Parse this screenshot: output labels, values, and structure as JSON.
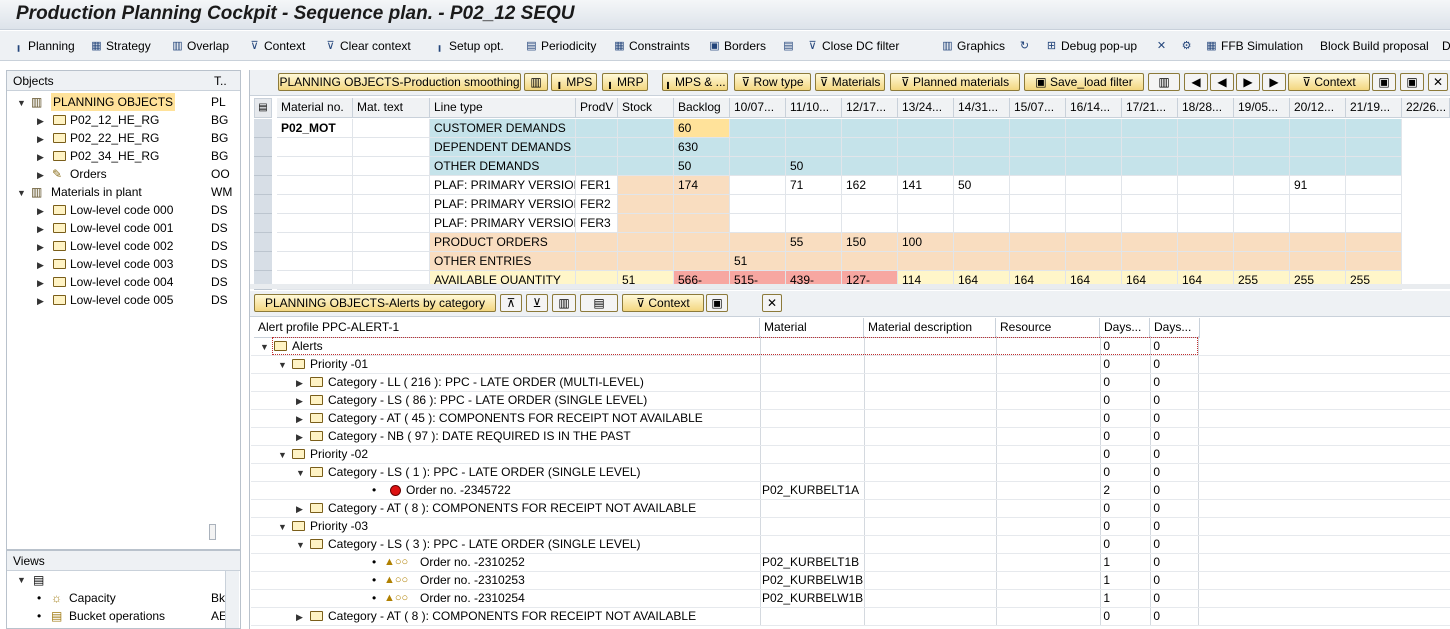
{
  "window": {
    "title": "Production Planning Cockpit - Sequence plan. - P02_12 SEQU"
  },
  "toolbar": {
    "items": [
      {
        "label": "Planning",
        "icon": "planning-icon"
      },
      {
        "label": "Strategy",
        "icon": "strategy-icon"
      },
      {
        "label": "Overlap",
        "icon": "overlap-icon"
      },
      {
        "label": "Context",
        "icon": "context-icon"
      },
      {
        "label": "Clear context",
        "icon": "clear-context-icon"
      },
      {
        "label": "Setup opt.",
        "icon": "setup-icon"
      },
      {
        "label": "Periodicity",
        "icon": "periodicity-icon"
      },
      {
        "label": "Constraints",
        "icon": "constraints-icon"
      },
      {
        "label": "Borders",
        "icon": "borders-icon"
      },
      {
        "label": "",
        "icon": "list-icon"
      },
      {
        "label": "Close DC filter",
        "icon": "filter-icon"
      },
      {
        "label": "Graphics",
        "icon": "graphics-icon"
      },
      {
        "label": "",
        "icon": "refresh-icon"
      },
      {
        "label": "Debug pop-up",
        "icon": "debug-icon"
      },
      {
        "label": "",
        "icon": "excel-icon"
      },
      {
        "label": "",
        "icon": "tools-icon"
      },
      {
        "label": "FFB Simulation",
        "icon": "simulation-icon"
      },
      {
        "label": "Block Build proposal",
        "icon": ""
      },
      {
        "label": "D",
        "icon": ""
      }
    ]
  },
  "objects_panel": {
    "header_col1": "Objects",
    "header_col2": "T..",
    "rows": [
      {
        "label": "PLANNING OBJECTS",
        "code": "PL"
      },
      {
        "label": "P02_12_HE_RG",
        "code": "BG"
      },
      {
        "label": "P02_22_HE_RG",
        "code": "BG"
      },
      {
        "label": "P02_34_HE_RG",
        "code": "BG"
      },
      {
        "label": "Orders",
        "code": "OO"
      },
      {
        "label": "Materials in plant",
        "code": "WM"
      },
      {
        "label": "Low-level code 000",
        "code": "DS"
      },
      {
        "label": "Low-level code 001",
        "code": "DS"
      },
      {
        "label": "Low-level code 002",
        "code": "DS"
      },
      {
        "label": "Low-level code 003",
        "code": "DS"
      },
      {
        "label": "Low-level code 004",
        "code": "DS"
      },
      {
        "label": "Low-level code 005",
        "code": "DS"
      }
    ]
  },
  "views_panel": {
    "header": "Views",
    "rows": [
      {
        "label": "Capacity",
        "code": "Bk"
      },
      {
        "label": "Bucket operations",
        "code": "AE"
      }
    ]
  },
  "upper_toolbar": {
    "buttons": [
      "PLANNING OBJECTS-Production smoothing",
      "",
      "MPS",
      "MRP",
      "MPS & ...",
      "Row type",
      "Materials",
      "Planned materials",
      "Save_load filter",
      "",
      "",
      "",
      "",
      "",
      "Context",
      "",
      "",
      ""
    ]
  },
  "upper_grid": {
    "headers": [
      "Material no.",
      "Mat. text",
      "Line type",
      "ProdV",
      "Stock",
      "Backlog",
      "10/07...",
      "11/10...",
      "12/17...",
      "13/24...",
      "14/31...",
      "15/07...",
      "16/14...",
      "17/21...",
      "18/28...",
      "19/05...",
      "20/12...",
      "21/19...",
      "22/26..."
    ],
    "material": "P02_MOT",
    "rows": [
      {
        "line": "CUSTOMER DEMANDS",
        "prodv": "",
        "stock": "",
        "vals": [
          "60",
          "",
          "",
          "",
          "",
          "",
          "",
          "",
          "",
          "",
          "",
          "",
          ""
        ],
        "style": "blue",
        "hl": {
          "0": "yellow"
        }
      },
      {
        "line": "DEPENDENT DEMANDS",
        "prodv": "",
        "stock": "",
        "vals": [
          "630",
          "",
          "",
          "",
          "",
          "",
          "",
          "",
          "",
          "",
          "",
          "",
          ""
        ],
        "style": "blue"
      },
      {
        "line": "OTHER DEMANDS",
        "prodv": "",
        "stock": "",
        "vals": [
          "50",
          "",
          "50",
          "",
          "",
          "",
          "",
          "",
          "",
          "",
          "",
          "",
          ""
        ],
        "style": "blue"
      },
      {
        "line": "PLAF: PRIMARY VERSION",
        "prodv": "FER1",
        "stock": "",
        "vals": [
          "174",
          "",
          "71",
          "162",
          "141",
          "50",
          "",
          "",
          "",
          "",
          "",
          "91",
          ""
        ],
        "style": "white"
      },
      {
        "line": "PLAF: PRIMARY VERSION",
        "prodv": "FER2",
        "stock": "",
        "vals": [
          "",
          "",
          "",
          "",
          "",
          "",
          "",
          "",
          "",
          "",
          "",
          "",
          ""
        ],
        "style": "white"
      },
      {
        "line": "PLAF: PRIMARY VERSION",
        "prodv": "FER3",
        "stock": "",
        "vals": [
          "",
          "",
          "",
          "",
          "",
          "",
          "",
          "",
          "",
          "",
          "",
          "",
          ""
        ],
        "style": "white"
      },
      {
        "line": "PRODUCT ORDERS",
        "prodv": "",
        "stock": "",
        "vals": [
          "",
          "",
          "55",
          "150",
          "100",
          "",
          "",
          "",
          "",
          "",
          "",
          "",
          ""
        ],
        "style": "orange"
      },
      {
        "line": "OTHER ENTRIES",
        "prodv": "",
        "stock": "",
        "vals": [
          "",
          "51",
          "",
          "",
          "",
          "",
          "",
          "",
          "",
          "",
          "",
          "",
          ""
        ],
        "style": "orange"
      },
      {
        "line": "AVAILABLE QUANTITY",
        "prodv": "",
        "stock": "51",
        "vals": [
          "566-",
          "515-",
          "439-",
          "127-",
          "114",
          "164",
          "164",
          "164",
          "164",
          "164",
          "255",
          "255",
          "255"
        ],
        "style": "avail"
      }
    ]
  },
  "lower_toolbar": {
    "buttons": [
      "PLANNING OBJECTS-Alerts by category",
      "",
      "",
      "",
      "",
      "Context",
      "",
      ""
    ]
  },
  "alerts": {
    "headers": [
      "Alert profile PPC-ALERT-1",
      "Material",
      "Material description",
      "Resource",
      "Days...",
      "Days..."
    ],
    "rows": [
      {
        "level": 0,
        "type": "folder-open",
        "label": "Alerts",
        "material": "",
        "d1": "0",
        "d2": "0"
      },
      {
        "level": 1,
        "type": "folder-open",
        "label": "Priority -01",
        "material": "",
        "d1": "0",
        "d2": "0"
      },
      {
        "level": 2,
        "type": "folder",
        "label": "Category  - LL ( 216 ): PPC - LATE ORDER (MULTI-LEVEL)",
        "material": "",
        "d1": "0",
        "d2": "0"
      },
      {
        "level": 2,
        "type": "folder",
        "label": "Category  - LS ( 86 ): PPC - LATE ORDER (SINGLE LEVEL)",
        "material": "",
        "d1": "0",
        "d2": "0"
      },
      {
        "level": 2,
        "type": "folder",
        "label": "Category  - AT ( 45 ): COMPONENTS FOR RECEIPT NOT AVAILABLE",
        "material": "",
        "d1": "0",
        "d2": "0"
      },
      {
        "level": 2,
        "type": "folder",
        "label": "Category  - NB ( 97 ): DATE REQUIRED IS IN THE PAST",
        "material": "",
        "d1": "0",
        "d2": "0"
      },
      {
        "level": 1,
        "type": "folder-open",
        "label": "Priority -02",
        "material": "",
        "d1": "0",
        "d2": "0"
      },
      {
        "level": 2,
        "type": "folder-open",
        "label": "Category  - LS ( 1 ): PPC - LATE ORDER (SINGLE LEVEL)",
        "material": "",
        "d1": "0",
        "d2": "0"
      },
      {
        "level": 3,
        "type": "red",
        "label": "Order no. -2345722",
        "material": "P02_KURBELT1A",
        "d1": "2",
        "d2": "0"
      },
      {
        "level": 2,
        "type": "folder",
        "label": "Category  - AT ( 8 ): COMPONENTS FOR RECEIPT NOT AVAILABLE",
        "material": "",
        "d1": "0",
        "d2": "0"
      },
      {
        "level": 1,
        "type": "folder-open",
        "label": "Priority -03",
        "material": "",
        "d1": "0",
        "d2": "0"
      },
      {
        "level": 2,
        "type": "folder-open",
        "label": "Category  - LS ( 3 ): PPC - LATE ORDER (SINGLE LEVEL)",
        "material": "",
        "d1": "0",
        "d2": "0"
      },
      {
        "level": 3,
        "type": "yellow",
        "label": "Order no. -2310252",
        "material": "P02_KURBELT1B",
        "d1": "1",
        "d2": "0"
      },
      {
        "level": 3,
        "type": "yellow",
        "label": "Order no. -2310253",
        "material": "P02_KURBELW1B",
        "d1": "1",
        "d2": "0"
      },
      {
        "level": 3,
        "type": "yellow",
        "label": "Order no. -2310254",
        "material": "P02_KURBELW1B",
        "d1": "1",
        "d2": "0"
      },
      {
        "level": 2,
        "type": "folder",
        "label": "Category  - AT ( 8 ): COMPONENTS FOR RECEIPT NOT AVAILABLE",
        "material": "",
        "d1": "0",
        "d2": "0"
      }
    ]
  },
  "colors": {
    "blue": "#c5e3ea",
    "orange": "#f9ddc0",
    "yellow": "#ffe29a",
    "red": "#f7a7a1",
    "availYellow": "#fff6c9"
  }
}
